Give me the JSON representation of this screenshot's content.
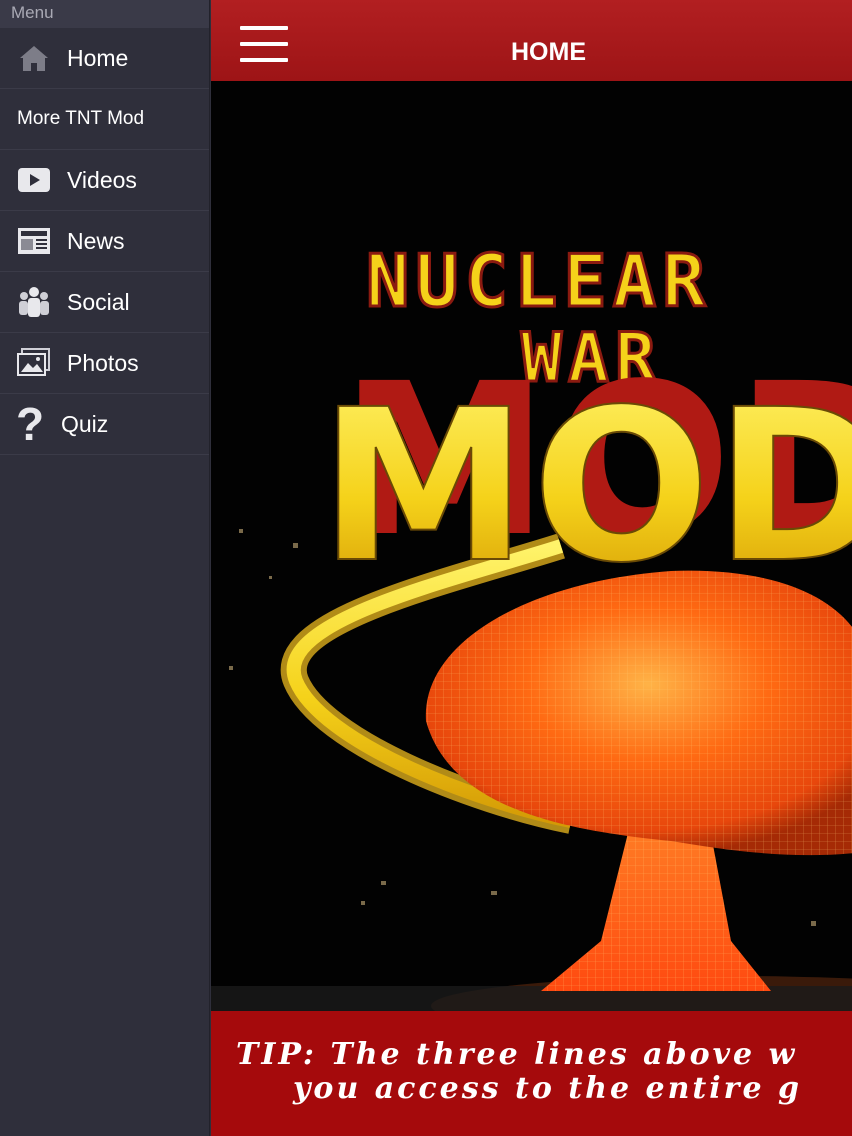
{
  "sidebar": {
    "header": "Menu",
    "items": [
      {
        "label": "Home",
        "icon": "home-icon"
      },
      {
        "label": "More TNT Mod",
        "icon": ""
      },
      {
        "label": "Videos",
        "icon": "play-icon"
      },
      {
        "label": "News",
        "icon": "newspaper-icon"
      },
      {
        "label": "Social",
        "icon": "people-icon"
      },
      {
        "label": "Photos",
        "icon": "photos-icon"
      },
      {
        "label": "Quiz",
        "icon": "question-icon"
      }
    ]
  },
  "topbar": {
    "title": "HOME",
    "color": "#a9191b"
  },
  "hero": {
    "title_line1": "NUCLEAR",
    "title_line2": "WAR",
    "title_line3": "MOD"
  },
  "tip": {
    "line1": "TIP: The three lines above w",
    "line2": "you access to the entire g"
  },
  "colors": {
    "sidebar": "#2f2f3b",
    "topbar": "#a9191b",
    "tipbar": "#a50a0c",
    "title_yellow": "#f5d21a"
  }
}
